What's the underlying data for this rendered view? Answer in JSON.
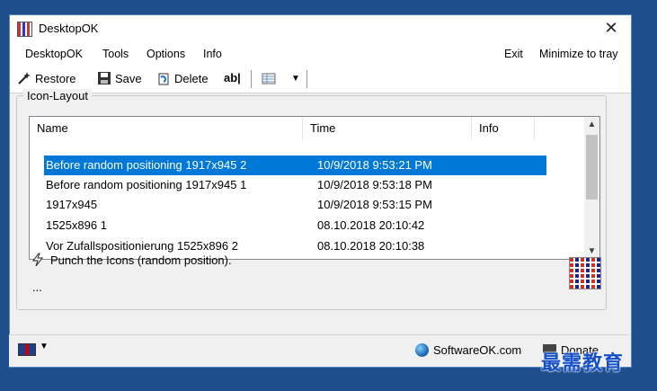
{
  "window": {
    "title": "DesktopOK",
    "close_label": "✕"
  },
  "menu": {
    "items": [
      "DesktopOK",
      "Tools",
      "Options",
      "Info"
    ],
    "right_items": [
      "Exit",
      "Minimize to tray"
    ]
  },
  "toolbar": {
    "restore_label": "Restore",
    "save_label": "Save",
    "delete_label": "Delete",
    "rename_label": "ab|",
    "view_dropdown": "▼"
  },
  "group": {
    "label": "Icon-Layout"
  },
  "table": {
    "columns": [
      "Name",
      "Time",
      "Info"
    ],
    "rows": [
      {
        "name": "Before random positioning 1917x945 2",
        "time": "10/9/2018 9:53:21 PM",
        "info": "",
        "selected": true
      },
      {
        "name": "Before random positioning 1917x945 1",
        "time": "10/9/2018 9:53:18 PM",
        "info": "",
        "selected": false
      },
      {
        "name": "1917x945",
        "time": "10/9/2018 9:53:15 PM",
        "info": "",
        "selected": false
      },
      {
        "name": "1525x896 1",
        "time": "08.10.2018 20:10:42",
        "info": "",
        "selected": false
      },
      {
        "name": "Vor Zufallspositionierung 1525x896 2",
        "time": "08.10.2018 20:10:38",
        "info": "",
        "selected": false
      }
    ]
  },
  "punch": {
    "text": "Punch the Icons (random position)."
  },
  "ellipsis": "...",
  "status": {
    "website": "SoftwareOK.com",
    "donate": "Donate"
  },
  "watermark": "最需教育",
  "colors": {
    "selection": "#0078d7",
    "frame": "#1e4f8c"
  }
}
